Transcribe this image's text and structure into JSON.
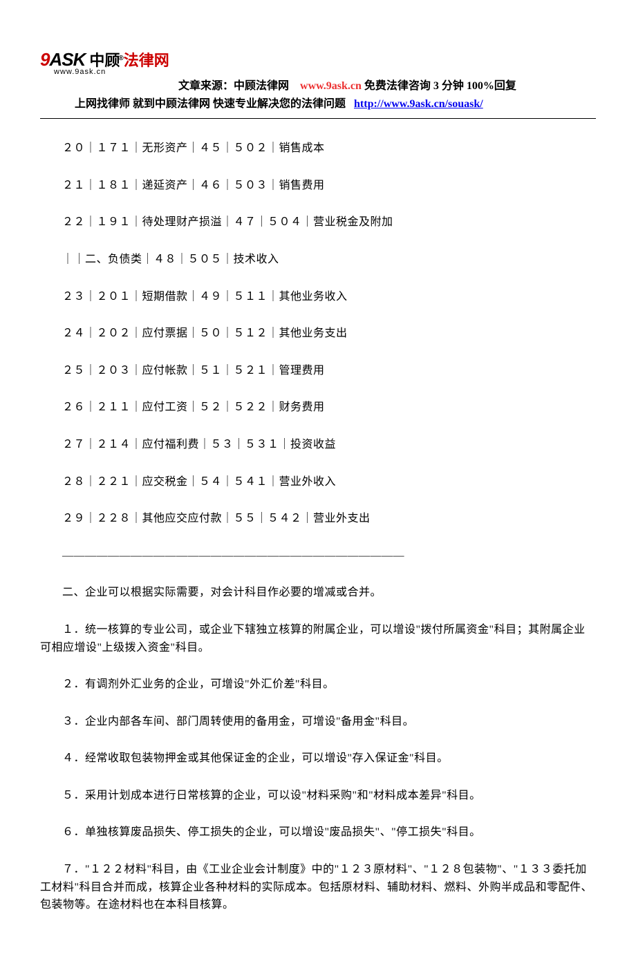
{
  "logo": {
    "nine": "9",
    "ask": "ASK",
    "cn_zhong": "中顾",
    "cn_falv": "法律网",
    "r": "®",
    "url": "www.9ask.cn"
  },
  "source_line": {
    "prefix": "文章来源：中顾法律网",
    "link": "www.9ask.cn",
    "suffix": " 免费法律咨询 3 分钟 100%回复"
  },
  "nav_line": {
    "prefix": "上网找律师  就到中顾法律网  快速专业解决您的法律问题",
    "link": "http://www.9ask.cn/souask/"
  },
  "rows": [
    "２０｜１７１｜无形资产｜４５｜５０２｜销售成本",
    "２１｜１８１｜递延资产｜４６｜５０３｜销售费用",
    "２２｜１９１｜待处理财产损溢｜４７｜５０４｜营业税金及附加",
    "｜｜二、负债类｜４８｜５０５｜技术收入",
    "２３｜２０１｜短期借款｜４９｜５１１｜其他业务收入",
    "２４｜２０２｜应付票据｜５０｜５１２｜其他业务支出",
    "２５｜２０３｜应付帐款｜５１｜５２１｜管理费用",
    "２６｜２１１｜应付工资｜５２｜５２２｜财务费用",
    "２７｜２１４｜应付福利费｜５３｜５３１｜投资收益",
    "２８｜２２１｜应交税金｜５４｜５４１｜营业外收入",
    "２９｜２２８｜其他应交应付款｜５５｜５４２｜营业外支出"
  ],
  "divider": "——————————————————————————————",
  "section2_title": "二、企业可以根据实际需要，对会计科目作必要的增减或合并。",
  "items": [
    "１．统一核算的专业公司，或企业下辖独立核算的附属企业，可以增设\"拨付所属资金\"科目；其附属企业可相应增设\"上级拨入资金\"科目。",
    "２．有调剂外汇业务的企业，可增设\"外汇价差\"科目。",
    "３．企业内部各车间、部门周转使用的备用金，可增设\"备用金\"科目。",
    "４．经常收取包装物押金或其他保证金的企业，可以增设\"存入保证金\"科目。",
    "５．采用计划成本进行日常核算的企业，可以设\"材料采购\"和\"材料成本差异\"科目。",
    "６．单独核算废品损失、停工损失的企业，可以增设\"废品损失\"、\"停工损失\"科目。",
    "７．\"１２２材料\"科目，由《工业企业会计制度》中的\"１２３原材料\"、\"１２８包装物\"、\"１３３委托加工材料\"科目合并而成，核算企业各种材料的实际成本。包括原材料、辅助材料、燃料、外购半成品和零配件、包装物等。在途材料也在本科目核算。"
  ]
}
